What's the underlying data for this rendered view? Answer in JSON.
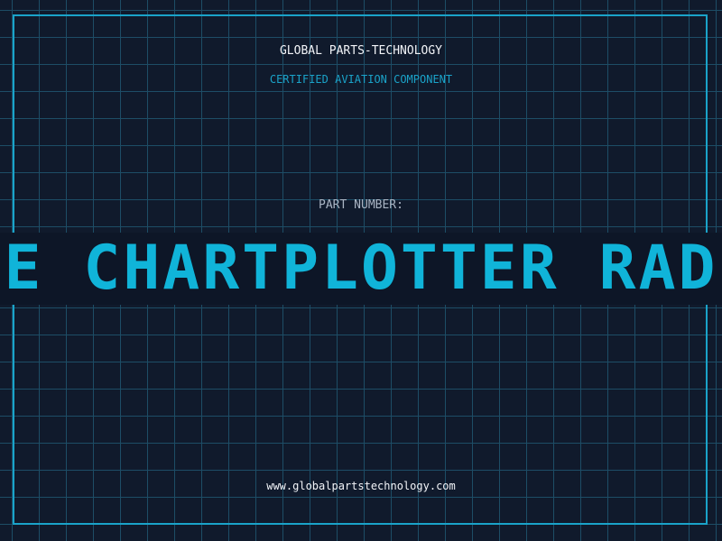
{
  "header": {
    "company": "GLOBAL PARTS-TECHNOLOGY",
    "subtitle": "CERTIFIED AVIATION COMPONENT"
  },
  "part": {
    "label": "PART NUMBER:",
    "number": "E CHARTPLOTTER RAD"
  },
  "footer": {
    "website": "www.globalpartstechnology.com"
  },
  "colors": {
    "background": "#101a2c",
    "grid": "#1d4d66",
    "accent": "#1aa3c9",
    "text": "#f2f4f8"
  }
}
